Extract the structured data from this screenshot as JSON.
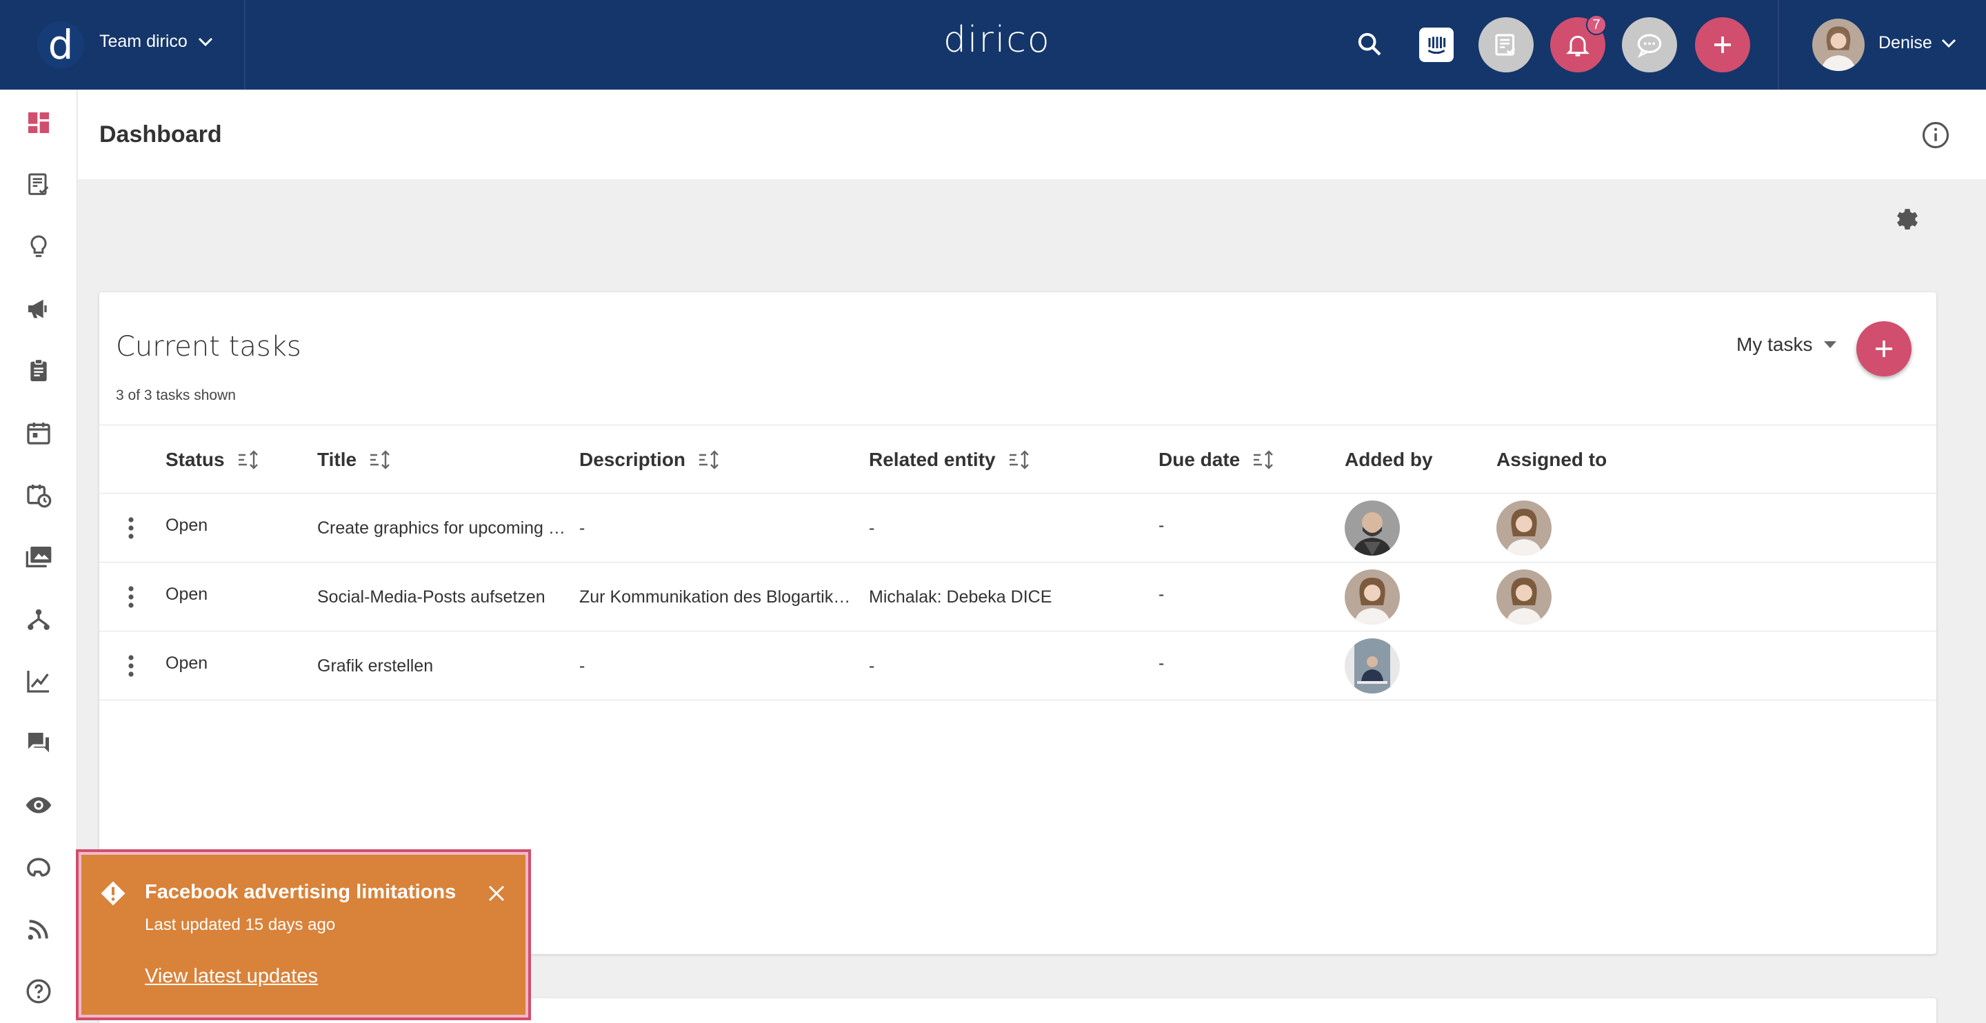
{
  "app": {
    "logo_letter": "d",
    "brand": "dirico",
    "team_label": "Team dirico",
    "user_name": "Denise",
    "notification_count": "7"
  },
  "colors": {
    "topbar": "#14366b",
    "accent": "#d14e6e",
    "toast": "#d9823a",
    "gray_button": "#c8c8c8"
  },
  "header": {
    "title": "Dashboard"
  },
  "nav": {
    "items": [
      "dashboard-icon",
      "tasks-icon",
      "ideas-icon",
      "campaigns-icon",
      "clipboard-icon",
      "calendar-icon",
      "schedule-icon",
      "media-icon",
      "hierarchy-icon",
      "analytics-icon",
      "chat-icon",
      "visibility-icon",
      "helmet-icon",
      "feed-icon",
      "help-icon"
    ]
  },
  "card": {
    "title": "Current tasks",
    "subtitle": "3 of 3 tasks shown",
    "filter_label": "My tasks"
  },
  "table": {
    "columns": [
      "Status",
      "Title",
      "Description",
      "Related entity",
      "Due date",
      "Added by",
      "Assigned to"
    ],
    "rows": [
      {
        "status": "Open",
        "title": "Create graphics for upcoming …",
        "description": "-",
        "related": "-",
        "due": "-"
      },
      {
        "status": "Open",
        "title": "Social-Media-Posts aufsetzen",
        "description": "Zur Kommunikation des Blogartik…",
        "related": "Michalak: Debeka DICE",
        "due": "-"
      },
      {
        "status": "Open",
        "title": "Grafik erstellen",
        "description": "-",
        "related": "-",
        "due": "-"
      }
    ]
  },
  "toast": {
    "title": "Facebook advertising limitations",
    "subtitle": "Last updated 15 days ago",
    "link": "View latest updates"
  }
}
